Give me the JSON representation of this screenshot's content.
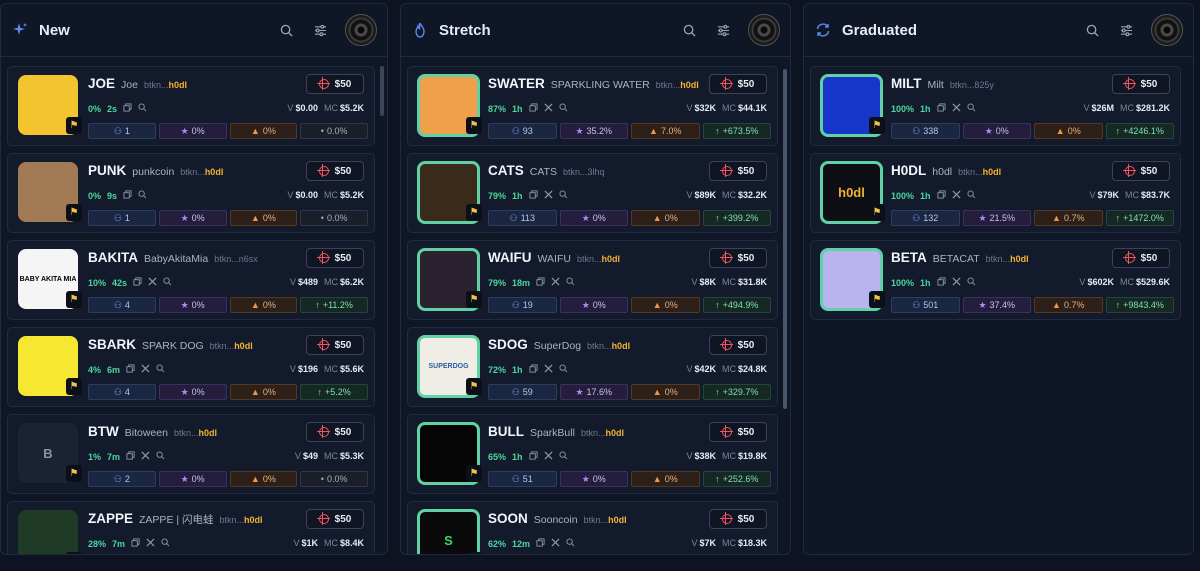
{
  "columns": [
    {
      "title": "New",
      "icon": "sparkle-icon",
      "cards": [
        {
          "ticker": "JOE",
          "name": "Joe",
          "addr_pre": "btkn...",
          "addr_hl": "h0dl",
          "buy": "$50",
          "pct": "0%",
          "age": "2s",
          "v": "$0.00",
          "mc": "$5.2K",
          "holders": "1",
          "snipers": "0%",
          "fees": "0%",
          "change": "0.0%",
          "change_type": "neutral",
          "thumb": {
            "bg": "#f4c430",
            "text": "",
            "fg": "#000",
            "ring": false
          }
        },
        {
          "ticker": "PUNK",
          "name": "punkcoin",
          "addr_pre": "btkn...",
          "addr_hl": "h0dl",
          "buy": "$50",
          "pct": "0%",
          "age": "9s",
          "v": "$0.00",
          "mc": "$5.2K",
          "holders": "1",
          "snipers": "0%",
          "fees": "0%",
          "change": "0.0%",
          "change_type": "neutral",
          "thumb": {
            "bg": "#a07a52",
            "text": "",
            "fg": "#000",
            "ring": false
          }
        },
        {
          "ticker": "BAKITA",
          "name": "BabyAkitaMia",
          "addr_pre": "btkn...n6sx",
          "addr_hl": "",
          "buy": "$50",
          "pct": "10%",
          "age": "42s",
          "v": "$489",
          "mc": "$6.2K",
          "holders": "4",
          "snipers": "0%",
          "fees": "0%",
          "change": "+11.2%",
          "change_type": "up",
          "thumb": {
            "bg": "#f5f5f5",
            "text": "BABY AKITA MIA",
            "fg": "#000",
            "ring": false
          }
        },
        {
          "ticker": "SBARK",
          "name": "SPARK DOG",
          "addr_pre": "btkn...",
          "addr_hl": "h0dl",
          "buy": "$50",
          "pct": "4%",
          "age": "6m",
          "v": "$196",
          "mc": "$5.6K",
          "holders": "4",
          "snipers": "0%",
          "fees": "0%",
          "change": "+5.2%",
          "change_type": "up",
          "thumb": {
            "bg": "#f6e832",
            "text": "",
            "fg": "#000",
            "ring": false
          }
        },
        {
          "ticker": "BTW",
          "name": "Bitoween",
          "addr_pre": "btkn...",
          "addr_hl": "h0dl",
          "buy": "$50",
          "pct": "1%",
          "age": "7m",
          "v": "$49",
          "mc": "$5.3K",
          "holders": "2",
          "snipers": "0%",
          "fees": "0%",
          "change": "0.0%",
          "change_type": "neutral",
          "thumb": {
            "bg": "#1a2233",
            "text": "B",
            "fg": "#8a93a6",
            "ring": false
          }
        },
        {
          "ticker": "ZAPPE",
          "name": "ZAPPE | 闪电蛙",
          "addr_pre": "btkn...",
          "addr_hl": "h0dl",
          "buy": "$50",
          "pct": "28%",
          "age": "7m",
          "v": "$1K",
          "mc": "$8.4K",
          "holders": "",
          "snipers": "",
          "fees": "",
          "change": "",
          "change_type": "neutral",
          "thumb": {
            "bg": "#1f3a26",
            "text": "",
            "fg": "#000",
            "ring": false
          }
        }
      ]
    },
    {
      "title": "Stretch",
      "icon": "flame-icon",
      "cards": [
        {
          "ticker": "SWATER",
          "name": "SPARKLING WATER",
          "addr_pre": "btkn...",
          "addr_hl": "h0dl",
          "buy": "$50",
          "pct": "87%",
          "age": "1h",
          "v": "$32K",
          "mc": "$44.1K",
          "holders": "93",
          "snipers": "35.2%",
          "fees": "7.0%",
          "change": "+673.5%",
          "change_type": "up",
          "thumb": {
            "bg": "#f0a04b",
            "text": "",
            "fg": "#000",
            "ring": true
          }
        },
        {
          "ticker": "CATS",
          "name": "CATS",
          "addr_pre": "btkn...3lhq",
          "addr_hl": "",
          "buy": "$50",
          "pct": "79%",
          "age": "1h",
          "v": "$89K",
          "mc": "$32.2K",
          "holders": "113",
          "snipers": "0%",
          "fees": "0%",
          "change": "+399.2%",
          "change_type": "up",
          "thumb": {
            "bg": "#3a2a1a",
            "text": "",
            "fg": "#e8b04a",
            "ring": true
          }
        },
        {
          "ticker": "WAIFU",
          "name": "WAIFU",
          "addr_pre": "btkn...",
          "addr_hl": "h0dl",
          "buy": "$50",
          "pct": "79%",
          "age": "18m",
          "v": "$8K",
          "mc": "$31.8K",
          "holders": "19",
          "snipers": "0%",
          "fees": "0%",
          "change": "+494.9%",
          "change_type": "up",
          "thumb": {
            "bg": "#2b2230",
            "text": "",
            "fg": "#000",
            "ring": true
          }
        },
        {
          "ticker": "SDOG",
          "name": "SuperDog",
          "addr_pre": "btkn...",
          "addr_hl": "h0dl",
          "buy": "$50",
          "pct": "72%",
          "age": "1h",
          "v": "$42K",
          "mc": "$24.8K",
          "holders": "59",
          "snipers": "17.6%",
          "fees": "0%",
          "change": "+329.7%",
          "change_type": "up",
          "thumb": {
            "bg": "#f0ede6",
            "text": "SUPERDOG",
            "fg": "#2b5aa0",
            "ring": true
          }
        },
        {
          "ticker": "BULL",
          "name": "SparkBull",
          "addr_pre": "btkn...",
          "addr_hl": "h0dl",
          "buy": "$50",
          "pct": "65%",
          "age": "1h",
          "v": "$38K",
          "mc": "$19.8K",
          "holders": "51",
          "snipers": "0%",
          "fees": "0%",
          "change": "+252.6%",
          "change_type": "up",
          "thumb": {
            "bg": "#050505",
            "text": "",
            "fg": "#fff",
            "ring": true
          }
        },
        {
          "ticker": "SOON",
          "name": "Sooncoin",
          "addr_pre": "btkn...",
          "addr_hl": "h0dl",
          "buy": "$50",
          "pct": "62%",
          "age": "12m",
          "v": "$7K",
          "mc": "$18.3K",
          "holders": "",
          "snipers": "",
          "fees": "",
          "change": "",
          "change_type": "neutral",
          "thumb": {
            "bg": "#0a0a0a",
            "text": "S",
            "fg": "#3ad66b",
            "ring": true
          }
        }
      ]
    },
    {
      "title": "Graduated",
      "icon": "refresh-icon",
      "cards": [
        {
          "ticker": "MILT",
          "name": "Milt",
          "addr_pre": "btkn...825y",
          "addr_hl": "",
          "buy": "$50",
          "pct": "100%",
          "age": "1h",
          "v": "$26M",
          "mc": "$281.2K",
          "holders": "338",
          "snipers": "0%",
          "fees": "0%",
          "change": "+4246.1%",
          "change_type": "up",
          "thumb": {
            "bg": "#1636c9",
            "text": "",
            "fg": "#fff",
            "ring": true
          }
        },
        {
          "ticker": "H0DL",
          "name": "h0dl",
          "addr_pre": "btkn...",
          "addr_hl": "h0dl",
          "buy": "$50",
          "pct": "100%",
          "age": "1h",
          "v": "$79K",
          "mc": "$83.7K",
          "holders": "132",
          "snipers": "21.5%",
          "fees": "0.7%",
          "change": "+1472.0%",
          "change_type": "up",
          "thumb": {
            "bg": "#0d0f14",
            "text": "h0dl",
            "fg": "#f2b233",
            "ring": true
          }
        },
        {
          "ticker": "BETA",
          "name": "BETACAT",
          "addr_pre": "btkn...",
          "addr_hl": "h0dl",
          "buy": "$50",
          "pct": "100%",
          "age": "1h",
          "v": "$602K",
          "mc": "$529.6K",
          "holders": "501",
          "snipers": "37.4%",
          "fees": "0.7%",
          "change": "+9843.4%",
          "change_type": "up",
          "thumb": {
            "bg": "#b9b4ef",
            "text": "",
            "fg": "#fff",
            "ring": true
          }
        }
      ]
    }
  ],
  "labels": {
    "v": "V",
    "mc": "MC"
  },
  "colors": {
    "accent": "#5fd1a4",
    "up": "#4ed6a0",
    "buy_icon": "#ef5561"
  }
}
